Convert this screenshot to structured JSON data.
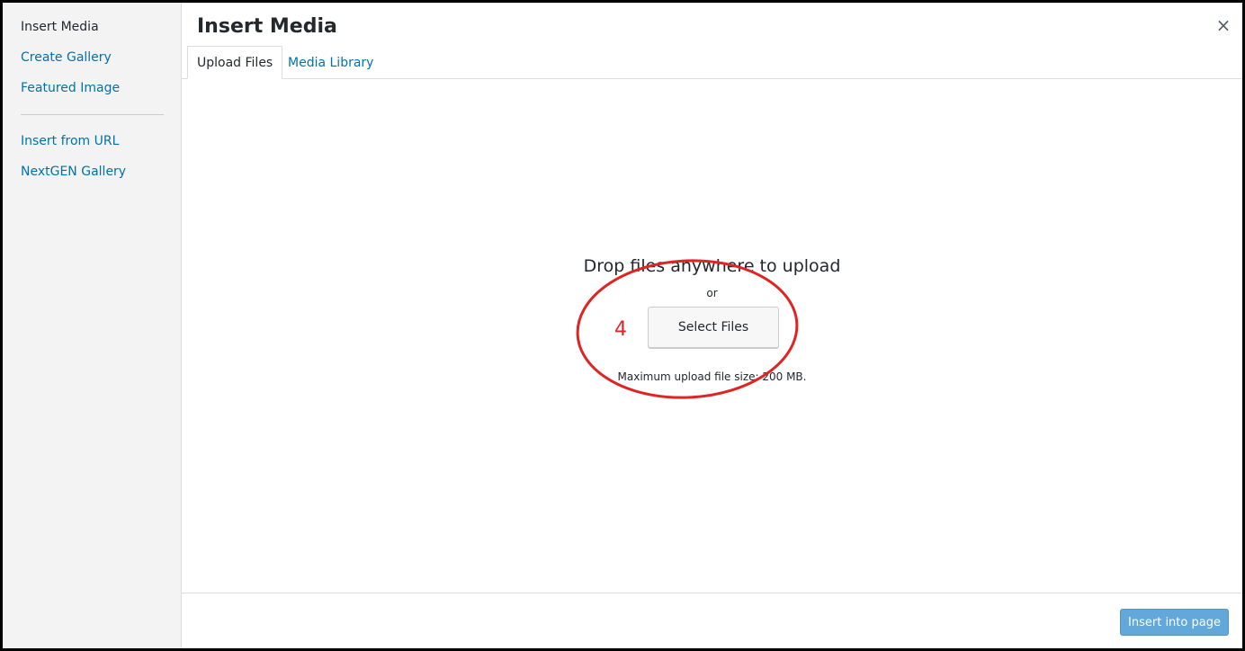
{
  "colors": {
    "link": "#0073aa",
    "text": "#23282d",
    "annotation": "#e02424",
    "primary_button": "#2e8ccf"
  },
  "sidebar": {
    "items": [
      {
        "label": "Insert Media",
        "active": true
      },
      {
        "label": "Create Gallery",
        "active": false
      },
      {
        "label": "Featured Image",
        "active": false
      },
      {
        "label": "Insert from URL",
        "active": false
      },
      {
        "label": "NextGEN Gallery",
        "active": false
      }
    ]
  },
  "header": {
    "title": "Insert Media",
    "close_icon": "close-icon",
    "close_glyph": "×"
  },
  "tabs": [
    {
      "label": "Upload Files",
      "active": true
    },
    {
      "label": "Media Library",
      "active": false
    }
  ],
  "upload": {
    "drop_text": "Drop files anywhere to upload",
    "or_text": "or",
    "select_button": "Select Files",
    "max_size_text": "Maximum upload file size: 200 MB."
  },
  "annotation": {
    "number": "4",
    "shape": "ellipse"
  },
  "footer": {
    "insert_button": "Insert into page"
  }
}
